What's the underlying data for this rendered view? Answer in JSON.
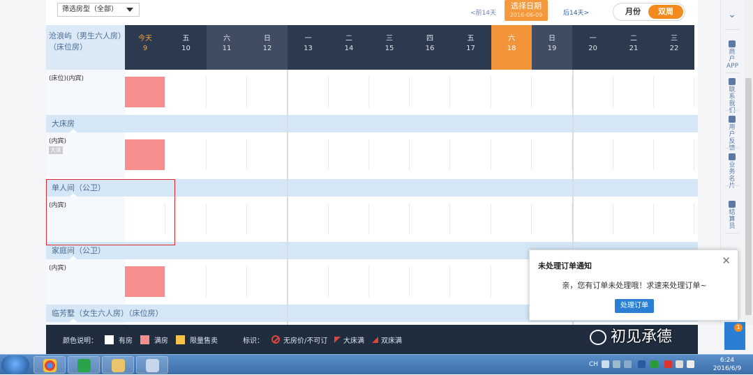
{
  "toolbar": {
    "filter_label": "筛选房型（全部）",
    "prev_label": "<前14天",
    "select_date_label": "选择日期",
    "select_date_value": "2016-06-09",
    "next_label": "后14天>",
    "month_label": "月份",
    "week_label": "双周"
  },
  "header": {
    "room_title": "沧浪屿（男生六人房）（床位房）"
  },
  "days": [
    {
      "dow": "今天",
      "date": "9"
    },
    {
      "dow": "五",
      "date": "10"
    },
    {
      "dow": "六",
      "date": "11"
    },
    {
      "dow": "日",
      "date": "12"
    },
    {
      "dow": "一",
      "date": "13"
    },
    {
      "dow": "二",
      "date": "14"
    },
    {
      "dow": "三",
      "date": "15"
    },
    {
      "dow": "四",
      "date": "16"
    },
    {
      "dow": "五",
      "date": "17"
    },
    {
      "dow": "六",
      "date": "18"
    },
    {
      "dow": "日",
      "date": "19"
    },
    {
      "dow": "一",
      "date": "20"
    },
    {
      "dow": "二",
      "date": "21"
    },
    {
      "dow": "三",
      "date": "22"
    }
  ],
  "sections": [
    {
      "title": "",
      "row_label": "(床位)(内宾)",
      "tag": "",
      "full_days": [
        0
      ]
    },
    {
      "title": "大床房",
      "row_label": "(内宾)",
      "tag": "大床",
      "full_days": [
        0
      ]
    },
    {
      "title": "单人间（公卫）",
      "row_label": "(内宾)",
      "tag": "",
      "full_days": []
    },
    {
      "title": "家庭间（公卫）",
      "row_label": "(内宾)",
      "tag": "",
      "full_days": [
        0
      ]
    },
    {
      "title": "临芳墅（女生六人房）（床位房）",
      "row_label": "",
      "tag": "",
      "full_days": []
    }
  ],
  "legend": {
    "color_label": "颜色说明：",
    "available": "有房",
    "full": "满房",
    "limited": "限量售卖",
    "mark_label": "标识：",
    "no_price": "无房价/不可订",
    "big_bed_full": "大床满",
    "twin_bed_full": "双床满",
    "colors": {
      "available": "#ffffff",
      "full": "#f78e8e",
      "limited": "#f5c24a"
    }
  },
  "sidebar": {
    "collapse_icon": "double-chevron-down-icon",
    "items": [
      {
        "label": "商户APP",
        "icon": "phone-icon"
      },
      {
        "label": "联系我们",
        "icon": "telephone-icon"
      },
      {
        "label": "用户反馈",
        "icon": "chat-bubble-icon"
      },
      {
        "label": "业务名片",
        "icon": "person-icon"
      },
      {
        "label": "结算员",
        "icon": "person-icon"
      }
    ]
  },
  "notification": {
    "title": "未处理订单通知",
    "message": "亲，您有订单未处理哦！求速来处理订单~",
    "button": "处理订单",
    "badge": "1"
  },
  "watermark": {
    "text": "初见承德"
  },
  "taskbar": {
    "tray_lang": "CH",
    "time": "6:24",
    "date": "2016/6/9"
  }
}
